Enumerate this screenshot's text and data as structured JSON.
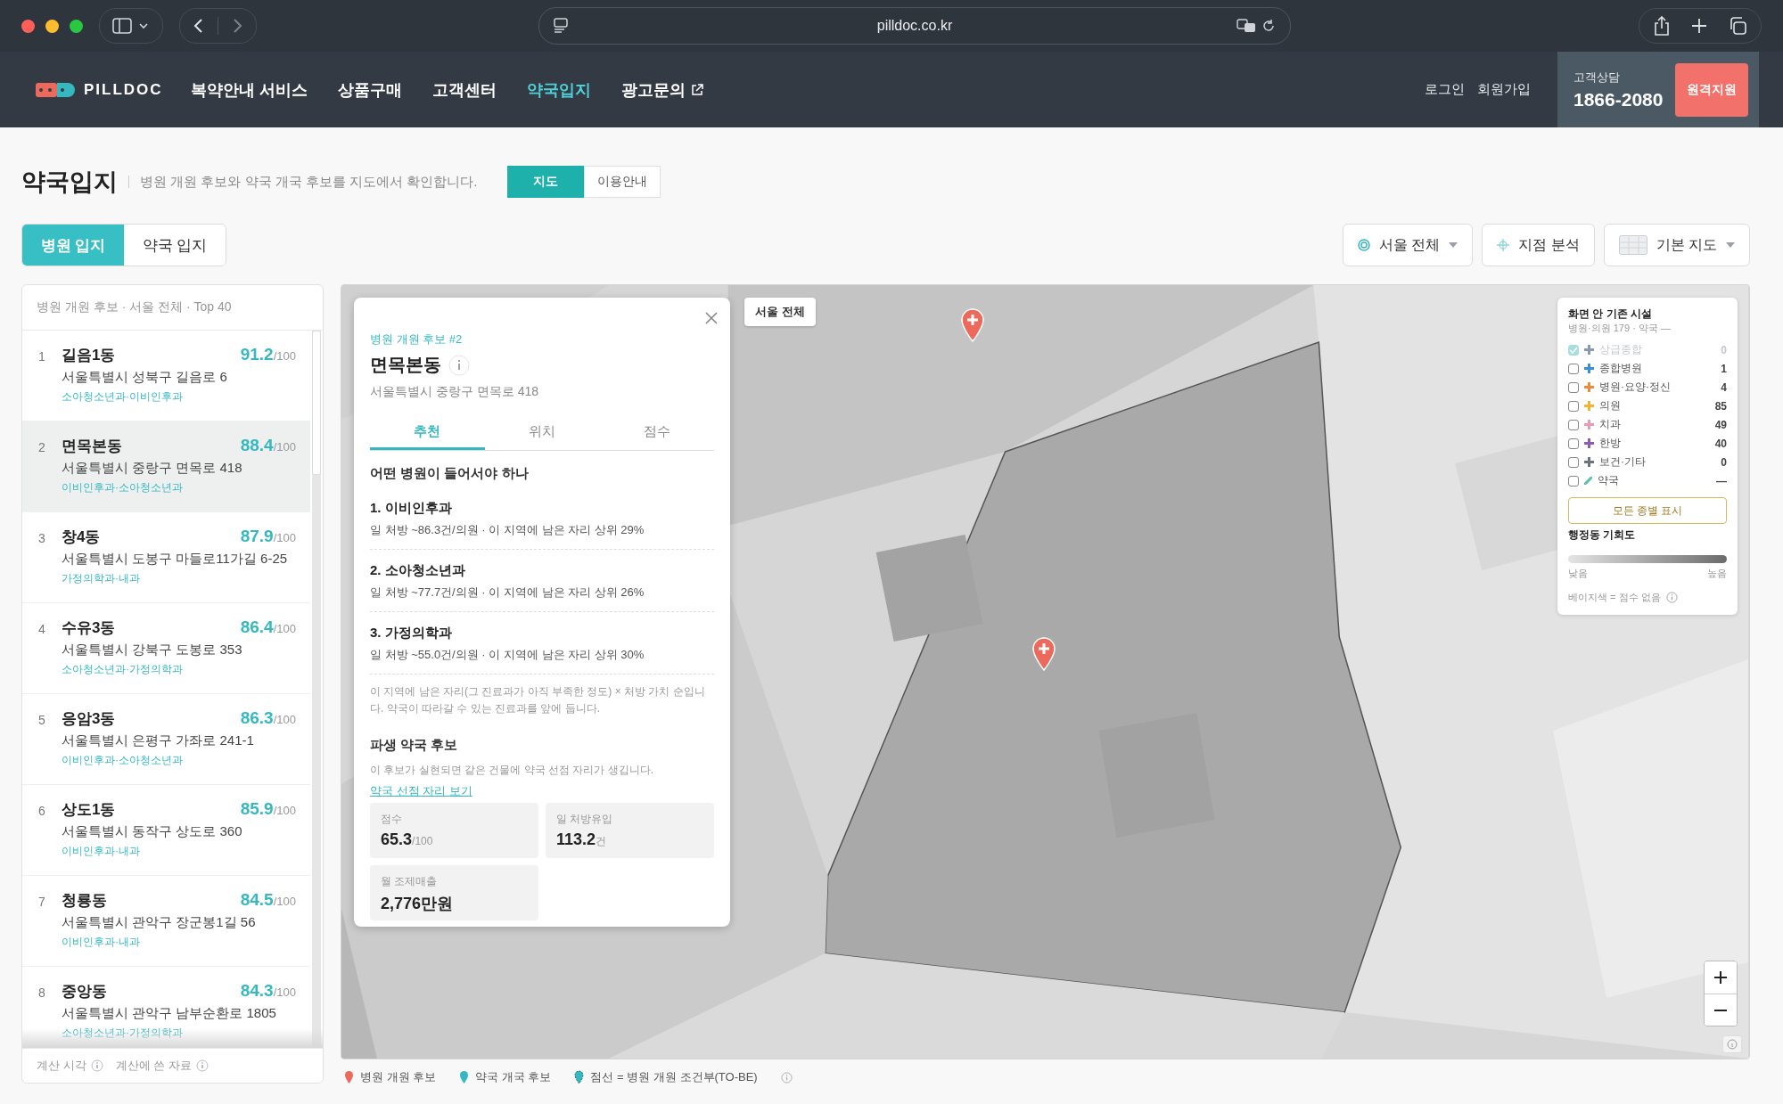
{
  "browser": {
    "url": "pilldoc.co.kr"
  },
  "header": {
    "logo": "PILLDOC",
    "nav": [
      {
        "label": "복약안내 서비스",
        "selected": false,
        "external": false
      },
      {
        "label": "상품구매",
        "selected": false,
        "external": false
      },
      {
        "label": "고객센터",
        "selected": false,
        "external": false
      },
      {
        "label": "약국입지",
        "selected": true,
        "external": false
      },
      {
        "label": "광고문의",
        "selected": false,
        "external": true
      }
    ],
    "login": "로그인",
    "signup": "회원가입",
    "support_label": "고객상담",
    "support_phone": "1866-2080",
    "remote_button": "원격지원"
  },
  "page": {
    "title": "약국입지",
    "description": "병원 개원 후보와 약국 개국 후보를 지도에서 확인합니다.",
    "view_tabs": [
      {
        "label": "지도",
        "selected": true
      },
      {
        "label": "이용안내",
        "selected": false
      }
    ]
  },
  "site_tabs": [
    {
      "label": "병원 입지",
      "selected": true
    },
    {
      "label": "약국 입지",
      "selected": false
    }
  ],
  "controls": [
    {
      "label": "서울 전체",
      "kind": "region"
    },
    {
      "label": "지점 분석",
      "kind": "point"
    },
    {
      "label": "기본 지도",
      "kind": "basemap"
    }
  ],
  "candidates": {
    "header": "병원 개원 후보 · 서울 전체 · Top 40",
    "items": [
      {
        "rank": "1",
        "name": "길음1동",
        "score": "91.2",
        "max": "/100",
        "address": "서울특별시 성북구 길음로 6",
        "specialties": "소아청소년과·이비인후과",
        "selected": false
      },
      {
        "rank": "2",
        "name": "면목본동",
        "score": "88.4",
        "max": "/100",
        "address": "서울특별시 중랑구 면목로 418",
        "specialties": "이비인후과·소아청소년과",
        "selected": true
      },
      {
        "rank": "3",
        "name": "창4동",
        "score": "87.9",
        "max": "/100",
        "address": "서울특별시 도봉구 마들로11가길 6-25",
        "specialties": "가정의학과·내과",
        "selected": false
      },
      {
        "rank": "4",
        "name": "수유3동",
        "score": "86.4",
        "max": "/100",
        "address": "서울특별시 강북구 도봉로 353",
        "specialties": "소아청소년과·가정의학과",
        "selected": false
      },
      {
        "rank": "5",
        "name": "응암3동",
        "score": "86.3",
        "max": "/100",
        "address": "서울특별시 은평구 가좌로 241-1",
        "specialties": "이비인후과·소아청소년과",
        "selected": false
      },
      {
        "rank": "6",
        "name": "상도1동",
        "score": "85.9",
        "max": "/100",
        "address": "서울특별시 동작구 상도로 360",
        "specialties": "이비인후과·내과",
        "selected": false
      },
      {
        "rank": "7",
        "name": "청룡동",
        "score": "84.5",
        "max": "/100",
        "address": "서울특별시 관악구 장군봉1길 56",
        "specialties": "이비인후과·내과",
        "selected": false
      },
      {
        "rank": "8",
        "name": "중앙동",
        "score": "84.3",
        "max": "/100",
        "address": "서울특별시 관악구 남부순환로 1805",
        "specialties": "소아청소년과·가정의학과",
        "selected": false
      }
    ],
    "footer": [
      "계산 시각",
      "계산에 쓴 자료"
    ]
  },
  "popup": {
    "eyebrow": "병원 개원 후보 #2",
    "name": "면목본동",
    "address": "서울특별시 중랑구 면목로 418",
    "tabs": [
      {
        "label": "추천",
        "selected": true
      },
      {
        "label": "위치",
        "selected": false
      },
      {
        "label": "점수",
        "selected": false
      }
    ],
    "section_title": "어떤 병원이 들어서야 하나",
    "recommendations": [
      {
        "title": "1. 이비인후과",
        "detail": "일 처방 ~86.3건/의원 · 이 지역에 남은 자리 상위 29%"
      },
      {
        "title": "2. 소아청소년과",
        "detail": "일 처방 ~77.7건/의원 · 이 지역에 남은 자리 상위 26%"
      },
      {
        "title": "3. 가정의학과",
        "detail": "일 처방 ~55.0건/의원 · 이 지역에 남은 자리 상위 30%"
      }
    ],
    "note": "이 지역에 남은 자리(그 진료과가 아직 부족한 정도) × 처방 가치 순입니다. 약국이 따라갈 수 있는 진료과를 앞에 둡니다.",
    "derived_title": "파생 약국 후보",
    "derived_text": "이 후보가 실현되면 같은 건물에 약국 선점 자리가 생깁니다.",
    "link": "약국 선점 자리 보기",
    "stats": [
      {
        "label": "점수",
        "value": "65.3",
        "unit": "/100"
      },
      {
        "label": "일 처방유입",
        "value": "113.2",
        "unit": "건"
      },
      {
        "label": "월 조제매출",
        "value": "2,776만원"
      }
    ]
  },
  "map": {
    "region_label": "서울 전체",
    "legend": {
      "title": "화면 안 기존 시설",
      "subtitle": "병원·의원 179 · 약국 —",
      "items": [
        {
          "label": "상급종합",
          "count": "0",
          "color": "#8a9ab0",
          "kind": "cross",
          "checked": true,
          "disabled": true
        },
        {
          "label": "종합병원",
          "count": "1",
          "color": "#3b8fd4",
          "kind": "cross",
          "checked": false,
          "disabled": false
        },
        {
          "label": "병원·요양·정신",
          "count": "4",
          "color": "#ef8a3a",
          "kind": "cross",
          "checked": false,
          "disabled": false
        },
        {
          "label": "의원",
          "count": "85",
          "color": "#f2b530",
          "kind": "cross",
          "checked": false,
          "disabled": false
        },
        {
          "label": "치과",
          "count": "49",
          "color": "#e89ab2",
          "kind": "cross",
          "checked": false,
          "disabled": false
        },
        {
          "label": "한방",
          "count": "40",
          "color": "#8a5cb8",
          "kind": "cross",
          "checked": false,
          "disabled": false
        },
        {
          "label": "보건·기타",
          "count": "0",
          "color": "#6b7280",
          "kind": "cross",
          "checked": false,
          "disabled": false
        },
        {
          "label": "약국",
          "count": "—",
          "color": "#5bbfae",
          "kind": "pill",
          "checked": false,
          "disabled": false
        }
      ],
      "button": "모든 종별 표시",
      "scale_title": "행정동 기회도",
      "low": "낮음",
      "high": "높음",
      "note": "베이지색 = 점수 없음"
    }
  },
  "map_legend": [
    {
      "label": "병원 개원 후보",
      "kind": "hospital"
    },
    {
      "label": "약국 개국 후보",
      "kind": "pharmacy"
    },
    {
      "label": "점선 = 병원 개원 조건부(TO-BE)",
      "kind": "conditional"
    }
  ]
}
